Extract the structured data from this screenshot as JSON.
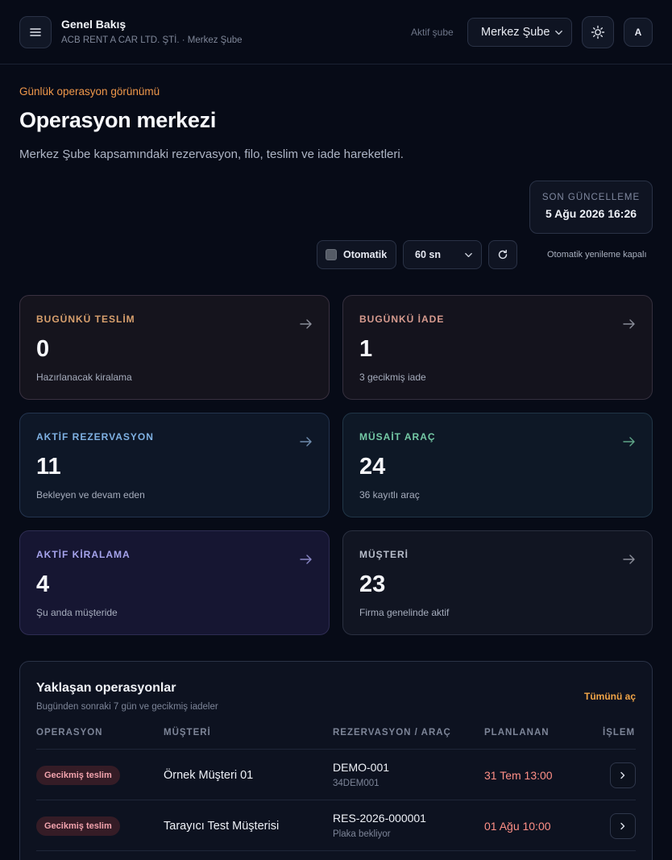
{
  "header": {
    "title": "Genel Bakış",
    "subtitle": "ACB RENT A CAR LTD. ŞTİ. · Merkez Şube",
    "branch_label": "Aktif şube",
    "branch_value": "Merkez Şube",
    "avatar_initial": "A",
    "icons": [
      "menu-icon",
      "chevron-down-icon",
      "sun-icon"
    ]
  },
  "hero": {
    "eyebrow": "Günlük operasyon görünümü",
    "title": "Operasyon merkezi",
    "description": "Merkez Şube kapsamındaki rezervasyon, filo, teslim ve iade hareketleri.",
    "last_update_label": "SON GÜNCELLEME",
    "last_update_value": "5 Ağu 2026 16:26",
    "auto_label": "Otomatik",
    "auto_checked": false,
    "interval_value": "60 sn",
    "auto_status": "Otomatik yenileme kapalı"
  },
  "cards": [
    {
      "label": "BUGÜNKÜ TESLİM",
      "value": "0",
      "sub": "Hazırlanacak kiralama",
      "accent": "#d8a06d"
    },
    {
      "label": "BUGÜNKÜ İADE",
      "value": "1",
      "sub": "3 gecikmiş iade",
      "accent": "#d69a8e"
    },
    {
      "label": "AKTİF REZERVASYON",
      "value": "11",
      "sub": "Bekleyen ve devam eden",
      "accent": "#7fb1e3"
    },
    {
      "label": "MÜSAİT ARAÇ",
      "value": "24",
      "sub": "36 kayıtlı araç",
      "accent": "#74c9a5"
    },
    {
      "label": "AKTİF KİRALAMA",
      "value": "4",
      "sub": "Şu anda müşteride",
      "accent": "#a6a4ec"
    },
    {
      "label": "MÜŞTERİ",
      "value": "23",
      "sub": "Firma genelinde aktif",
      "accent": "#b8becb"
    }
  ],
  "upcoming": {
    "title": "Yaklaşan operasyonlar",
    "subtitle": "Bugünden sonraki 7 gün ve gecikmiş iadeler",
    "see_all": "Tümünü aç",
    "columns": [
      "OPERASYON",
      "MÜŞTERİ",
      "REZERVASYON / ARAÇ",
      "PLANLANAN",
      "İŞLEM"
    ],
    "rows": [
      {
        "status": "Gecikmiş teslim",
        "customer": "Örnek Müşteri 01",
        "reservation": "DEMO-001",
        "plate": "34DEM001",
        "planned": "31 Tem 13:00"
      },
      {
        "status": "Gecikmiş teslim",
        "customer": "Tarayıcı Test Müşterisi",
        "reservation": "RES-2026-000001",
        "plate": "Plaka bekliyor",
        "planned": "01 Ağu 10:00"
      }
    ]
  }
}
